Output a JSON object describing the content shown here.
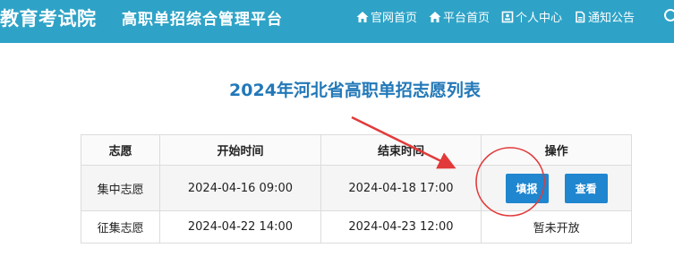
{
  "header": {
    "brand": "教育考试院",
    "subtitle": "高职单招综合管理平台",
    "nav": [
      {
        "label": "官网首页",
        "icon": "home-icon"
      },
      {
        "label": "平台首页",
        "icon": "home-icon"
      },
      {
        "label": "个人中心",
        "icon": "user-card-icon"
      },
      {
        "label": "通知公告",
        "icon": "document-icon"
      }
    ],
    "background_color": "#2ea3c7"
  },
  "main": {
    "title": "2024年河北省高职单招志愿列表",
    "table": {
      "headers": [
        "志愿",
        "开始时间",
        "结束时间",
        "操作"
      ],
      "rows": [
        {
          "name": "集中志愿",
          "start": "2024-04-16 09:00",
          "end": "2024-04-18 17:00",
          "actions": [
            "填报",
            "查看"
          ]
        },
        {
          "name": "征集志愿",
          "start": "2024-04-22 14:00",
          "end": "2024-04-23 12:00",
          "status": "暂未开放"
        }
      ]
    },
    "accent_color": "#1f86cf"
  }
}
